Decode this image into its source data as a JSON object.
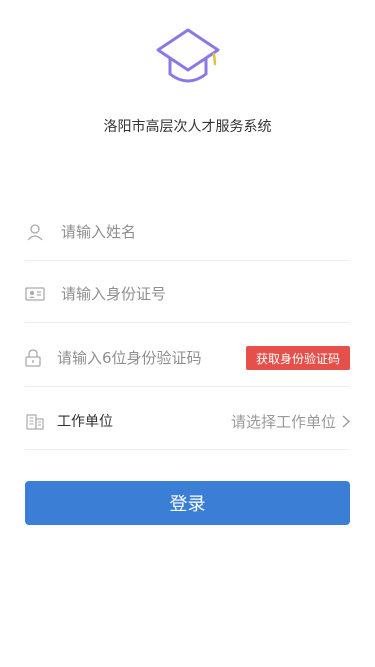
{
  "app": {
    "title": "洛阳市高层次人才服务系统"
  },
  "form": {
    "name": {
      "placeholder": "请输入姓名",
      "icon": "user-icon"
    },
    "id_card": {
      "placeholder": "请输入身份证号",
      "icon": "id-card-icon"
    },
    "code": {
      "placeholder": "请输入6位身份验证码",
      "icon": "lock-icon",
      "button_label": "获取身份验证码"
    },
    "unit": {
      "label": "工作单位",
      "placeholder": "请选择工作单位",
      "icon": "building-icon"
    }
  },
  "login": {
    "label": "登录"
  },
  "colors": {
    "accent": "#3a7fd5",
    "code_button": "#e6504a",
    "logo": "#8b78e6"
  }
}
